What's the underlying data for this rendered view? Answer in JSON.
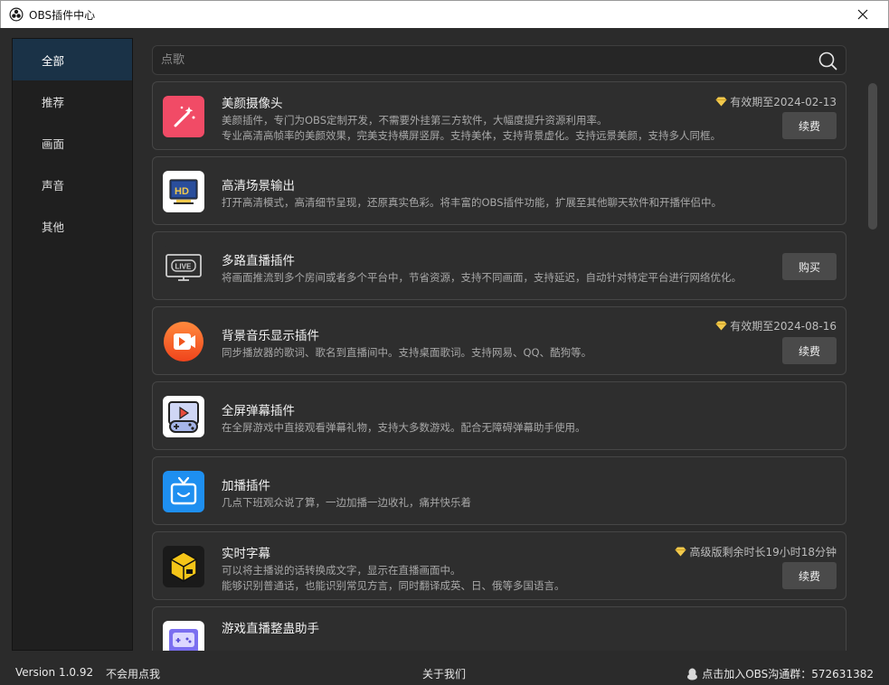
{
  "window": {
    "title": "OBS插件中心"
  },
  "sidebar": {
    "items": [
      {
        "label": "全部",
        "active": true
      },
      {
        "label": "推荐"
      },
      {
        "label": "画面"
      },
      {
        "label": "声音"
      },
      {
        "label": "其他"
      }
    ]
  },
  "search": {
    "placeholder": "点歌"
  },
  "plugins": [
    {
      "name": "美颜摄像头",
      "desc1": "美颜插件，专门为OBS定制开发，不需要外挂第三方软件，大幅度提升资源利用率。",
      "desc2": "专业高清高帧率的美颜效果，完美支持横屏竖屏。支持美体，支持背景虚化。支持远景美颜，支持多人同框。",
      "expiry": "有效期至2024-02-13",
      "button": "续费",
      "icon": "magic-wand-icon"
    },
    {
      "name": "高清场景输出",
      "desc1": "打开高清模式，高清细节呈现，还原真实色彩。将丰富的OBS插件功能，扩展至其他聊天软件和开播伴侣中。",
      "icon": "hd-monitor-icon"
    },
    {
      "name": "多路直播插件",
      "desc1": "将画面推流到多个房间或者多个平台中，节省资源，支持不同画面，支持延迟，自动针对特定平台进行网络优化。",
      "button": "购买",
      "icon": "live-tv-icon"
    },
    {
      "name": "背景音乐显示插件",
      "desc1": "同步播放器的歌词、歌名到直播间中。支持桌面歌词。支持网易、QQ、酷狗等。",
      "expiry": "有效期至2024-08-16",
      "button": "续费",
      "icon": "video-play-icon"
    },
    {
      "name": "全屏弹幕插件",
      "desc1": "在全屏游戏中直接观看弹幕礼物，支持大多数游戏。配合无障碍弹幕助手使用。",
      "icon": "gamepad-screen-icon"
    },
    {
      "name": "加播插件",
      "desc1": "几点下班观众说了算，一边加播一边收礼，痛并快乐着",
      "icon": "gift-tv-icon"
    },
    {
      "name": "实时字幕",
      "desc1": "可以将主播说的话转换成文字，显示在直播画面中。",
      "desc2": "能够识别普通话，也能识别常见方言，同时翻译成英、日、俄等多国语言。",
      "expiry": "高级版剩余时长19小时18分钟",
      "button": "续费",
      "icon": "subtitle-box-icon"
    },
    {
      "name": "游戏直播整蛊助手",
      "icon": "game-controller-icon"
    }
  ],
  "status": {
    "version": "Version 1.0.92",
    "help": "不会用点我",
    "about": "关于我们",
    "join": "点击加入OBS沟通群：572631382"
  }
}
